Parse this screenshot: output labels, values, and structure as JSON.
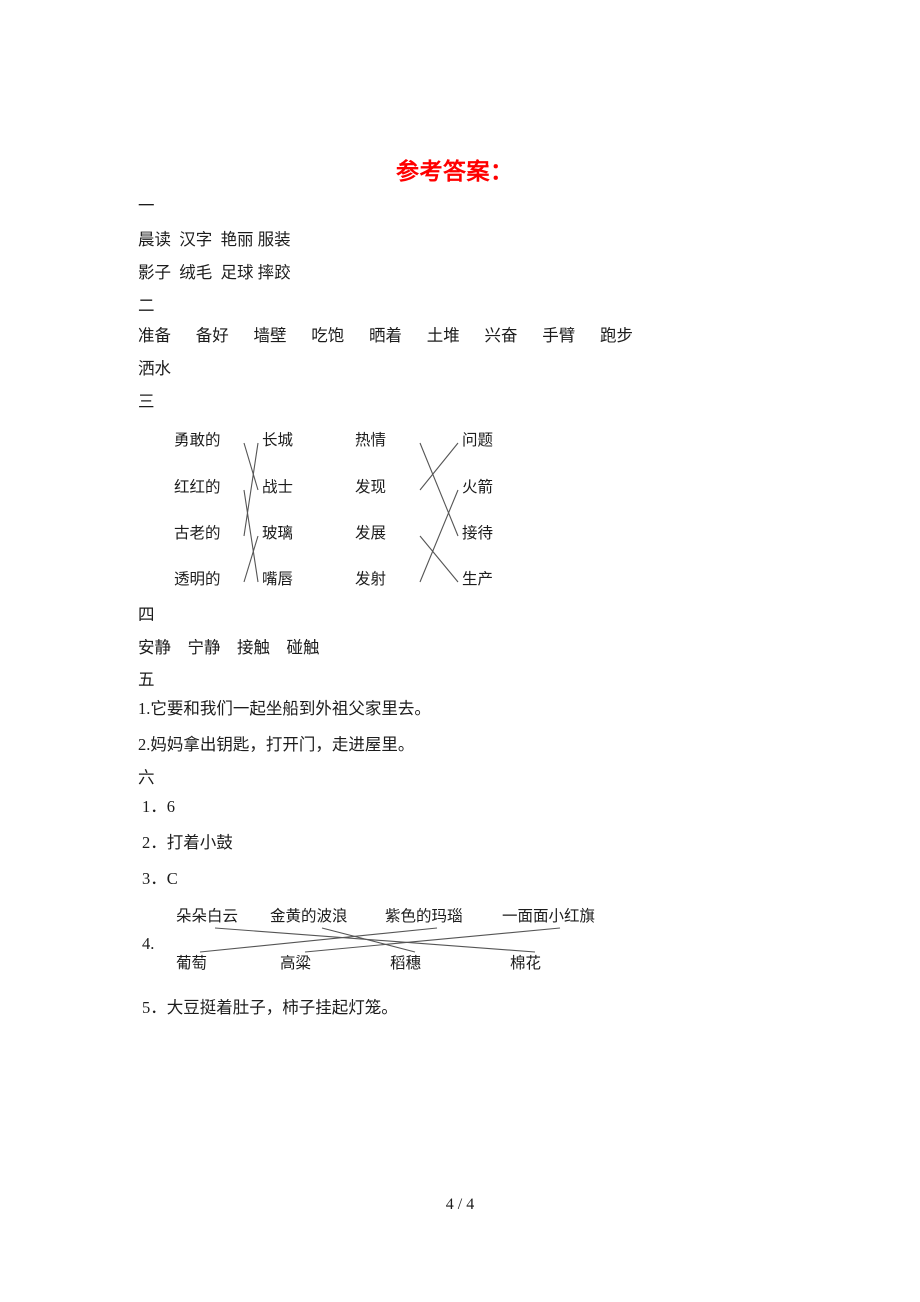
{
  "document": {
    "title": "参考答案：",
    "title_color": "#ff0000",
    "page_label": "4 / 4"
  },
  "sections": [
    {
      "marker": "一",
      "lines": [
        "晨读  汉字  艳丽 服装",
        "影子  绒毛  足球 摔跤"
      ]
    },
    {
      "marker": "二",
      "lines": [
        "准备      备好      墙壁      吃饱      晒着      土堆      兴奋      手臂      跑步",
        "洒水"
      ]
    },
    {
      "marker": "三",
      "type": "matching",
      "groups": [
        {
          "left": [
            "勇敢的",
            "红红的",
            "古老的",
            "透明的"
          ],
          "right": [
            "长城",
            "战士",
            "玻璃",
            "嘴唇"
          ],
          "pairs": [
            [
              0,
              1
            ],
            [
              1,
              3
            ],
            [
              2,
              0
            ],
            [
              3,
              2
            ]
          ]
        },
        {
          "left": [
            "热情",
            "发现",
            "发展",
            "发射"
          ],
          "right": [
            "问题",
            "火箭",
            "接待",
            "生产"
          ],
          "pairs": [
            [
              0,
              2
            ],
            [
              1,
              0
            ],
            [
              2,
              3
            ],
            [
              3,
              1
            ]
          ]
        }
      ]
    },
    {
      "marker": "四",
      "lines": [
        "安静    宁静    接触    碰触"
      ]
    },
    {
      "marker": "五",
      "lines": [
        "1.它要和我们一起坐船到外祖父家里去。",
        "2.妈妈拿出钥匙，打开门，走进屋里。"
      ]
    },
    {
      "marker": "六",
      "items": [
        "1．6",
        "2．打着小鼓",
        "3．C",
        "4.",
        "5．大豆挺着肚子，柿子挂起灯笼。"
      ],
      "matching": {
        "top": [
          "朵朵白云",
          "金黄的波浪",
          "紫色的玛瑙",
          "一面面小红旗"
        ],
        "bottom": [
          "葡萄",
          "高粱",
          "稻穗",
          "棉花"
        ],
        "pairs": [
          [
            0,
            3
          ],
          [
            1,
            2
          ],
          [
            2,
            0
          ],
          [
            3,
            1
          ]
        ]
      }
    }
  ]
}
